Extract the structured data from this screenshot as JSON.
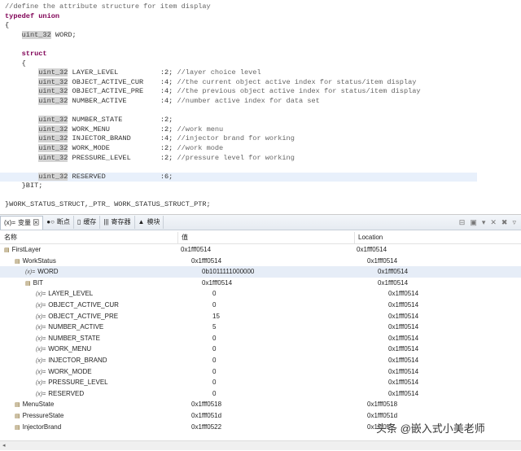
{
  "code": [
    {
      "t": "//define the attribute structure for item display",
      "k": "cm"
    },
    {
      "t": "typedef union",
      "k": "kw"
    },
    {
      "t": "{",
      "k": ""
    },
    {
      "i": "    ",
      "ty": "uint_32",
      "t": " WORD;"
    },
    {
      "t": "",
      "k": ""
    },
    {
      "t": "    struct",
      "k": "kw"
    },
    {
      "t": "    {",
      "k": ""
    },
    {
      "i": "        ",
      "ty": "uint_32",
      "t": " LAYER_LEVEL          :2; ",
      "c": "//layer choice level"
    },
    {
      "i": "        ",
      "ty": "uint_32",
      "t": " OBJECT_ACTIVE_CUR    :4; ",
      "c": "//the current object active index for status/item display"
    },
    {
      "i": "        ",
      "ty": "uint_32",
      "t": " OBJECT_ACTIVE_PRE    :4; ",
      "c": "//the previous object active index for status/item display"
    },
    {
      "i": "        ",
      "ty": "uint_32",
      "t": " NUMBER_ACTIVE        :4; ",
      "c": "//number active index for data set"
    },
    {
      "t": "",
      "k": ""
    },
    {
      "i": "        ",
      "ty": "uint_32",
      "t": " NUMBER_STATE         :2;"
    },
    {
      "i": "        ",
      "ty": "uint_32",
      "t": " WORK_MENU            :2; ",
      "c": "//work menu"
    },
    {
      "i": "        ",
      "ty": "uint_32",
      "t": " INJECTOR_BRAND       :4; ",
      "c": "//injector brand for working"
    },
    {
      "i": "        ",
      "ty": "uint_32",
      "t": " WORK_MODE            :2; ",
      "c": "//work mode"
    },
    {
      "i": "        ",
      "ty": "uint_32",
      "t": " PRESSURE_LEVEL       :2; ",
      "c": "//pressure level for working"
    },
    {
      "t": "",
      "k": ""
    },
    {
      "i": "        ",
      "ty": "uint_32",
      "t": " RESERVED             :6;",
      "hl": true
    },
    {
      "t": "    }BIT;",
      "k": ""
    },
    {
      "t": "",
      "k": ""
    },
    {
      "t": "}WORK_STATUS_STRUCT,_PTR_ WORK_STATUS_STRUCT_PTR;",
      "k": ""
    }
  ],
  "tabs": [
    {
      "icon": "(x)=",
      "label": "变量 ⊠"
    },
    {
      "icon": "●○",
      "label": "断点"
    },
    {
      "icon": "▯",
      "label": "缓存"
    },
    {
      "icon": "|||",
      "label": "寄存器"
    },
    {
      "icon": "▲",
      "label": "模块"
    }
  ],
  "columns": [
    "名称",
    "值",
    "Location"
  ],
  "rows": [
    {
      "d": 1,
      "i": "s",
      "n": "FirstLayer",
      "v": "0x1fff0514",
      "l": "0x1fff0514"
    },
    {
      "d": 2,
      "i": "s",
      "n": "WorkStatus",
      "v": "0x1fff0514",
      "l": "0x1fff0514"
    },
    {
      "d": 3,
      "i": "v",
      "n": "WORD",
      "v": "0b1011111000000",
      "l": "0x1fff0514",
      "sel": true
    },
    {
      "d": 3,
      "i": "s",
      "n": "BIT",
      "v": "0x1fff0514",
      "l": "0x1fff0514"
    },
    {
      "d": 4,
      "i": "v",
      "n": "LAYER_LEVEL",
      "v": "0",
      "l": "0x1fff0514"
    },
    {
      "d": 4,
      "i": "v",
      "n": "OBJECT_ACTIVE_CUR",
      "v": "0",
      "l": "0x1fff0514"
    },
    {
      "d": 4,
      "i": "v",
      "n": "OBJECT_ACTIVE_PRE",
      "v": "15",
      "l": "0x1fff0514"
    },
    {
      "d": 4,
      "i": "v",
      "n": "NUMBER_ACTIVE",
      "v": "5",
      "l": "0x1fff0514"
    },
    {
      "d": 4,
      "i": "v",
      "n": "NUMBER_STATE",
      "v": "0",
      "l": "0x1fff0514"
    },
    {
      "d": 4,
      "i": "v",
      "n": "WORK_MENU",
      "v": "0",
      "l": "0x1fff0514"
    },
    {
      "d": 4,
      "i": "v",
      "n": "INJECTOR_BRAND",
      "v": "0",
      "l": "0x1fff0514"
    },
    {
      "d": 4,
      "i": "v",
      "n": "WORK_MODE",
      "v": "0",
      "l": "0x1fff0514"
    },
    {
      "d": 4,
      "i": "v",
      "n": "PRESSURE_LEVEL",
      "v": "0",
      "l": "0x1fff0514"
    },
    {
      "d": 4,
      "i": "v",
      "n": "RESERVED",
      "v": "0",
      "l": "0x1fff0514"
    },
    {
      "d": 2,
      "i": "s",
      "n": "MenuState",
      "v": "0x1fff0518",
      "l": "0x1fff0518"
    },
    {
      "d": 2,
      "i": "s",
      "n": "PressureState",
      "v": "0x1fff051d",
      "l": "0x1fff051d"
    },
    {
      "d": 2,
      "i": "s",
      "n": "InjectorBrand",
      "v": "0x1fff0522",
      "l": "0x1fff05"
    }
  ],
  "watermark": "头条 @嵌入式小美老师"
}
